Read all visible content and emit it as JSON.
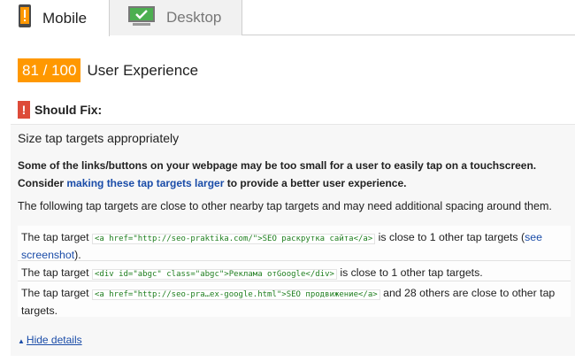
{
  "tabs": {
    "mobile_label": "Mobile",
    "desktop_label": "Desktop",
    "mobile_icon": "phone-warning-icon",
    "desktop_icon": "monitor-check-icon"
  },
  "score": {
    "value": "81 / 100",
    "title": "User Experience",
    "color": "#ff9800"
  },
  "should_fix": {
    "icon": "exclamation-icon",
    "label": "Should Fix:",
    "color": "#dd4b39"
  },
  "rule": {
    "title": "Size tap targets appropriately",
    "desc_before": "Some of the links/buttons on your webpage may be too small for a user to easily tap on a touchscreen. Consider ",
    "desc_link": "making these tap targets larger",
    "desc_after": " to provide a better user experience.",
    "sub": "The following tap targets are close to other nearby tap targets and may need additional spacing around them."
  },
  "targets": [
    {
      "prefix": "The tap target ",
      "code": "<a href=\"http://seo-praktika.com/\">SEO раскрутка сайта</a>",
      "middle": " is close to 1 other tap targets (",
      "link": "see screenshot",
      "suffix": ")."
    },
    {
      "prefix": "The tap target ",
      "code": "<div id=\"abgc\" class=\"abgc\">Реклама отGoogle</div>",
      "middle": " is close to 1 other tap targets."
    },
    {
      "prefix": "The tap target ",
      "code": "<a href=\"http://seo-pra…ex-google.html\">SEO продвижение</a>",
      "middle": " and 28 others are close to other tap targets."
    }
  ],
  "details": {
    "arrow": "▲",
    "label": "Hide details"
  }
}
